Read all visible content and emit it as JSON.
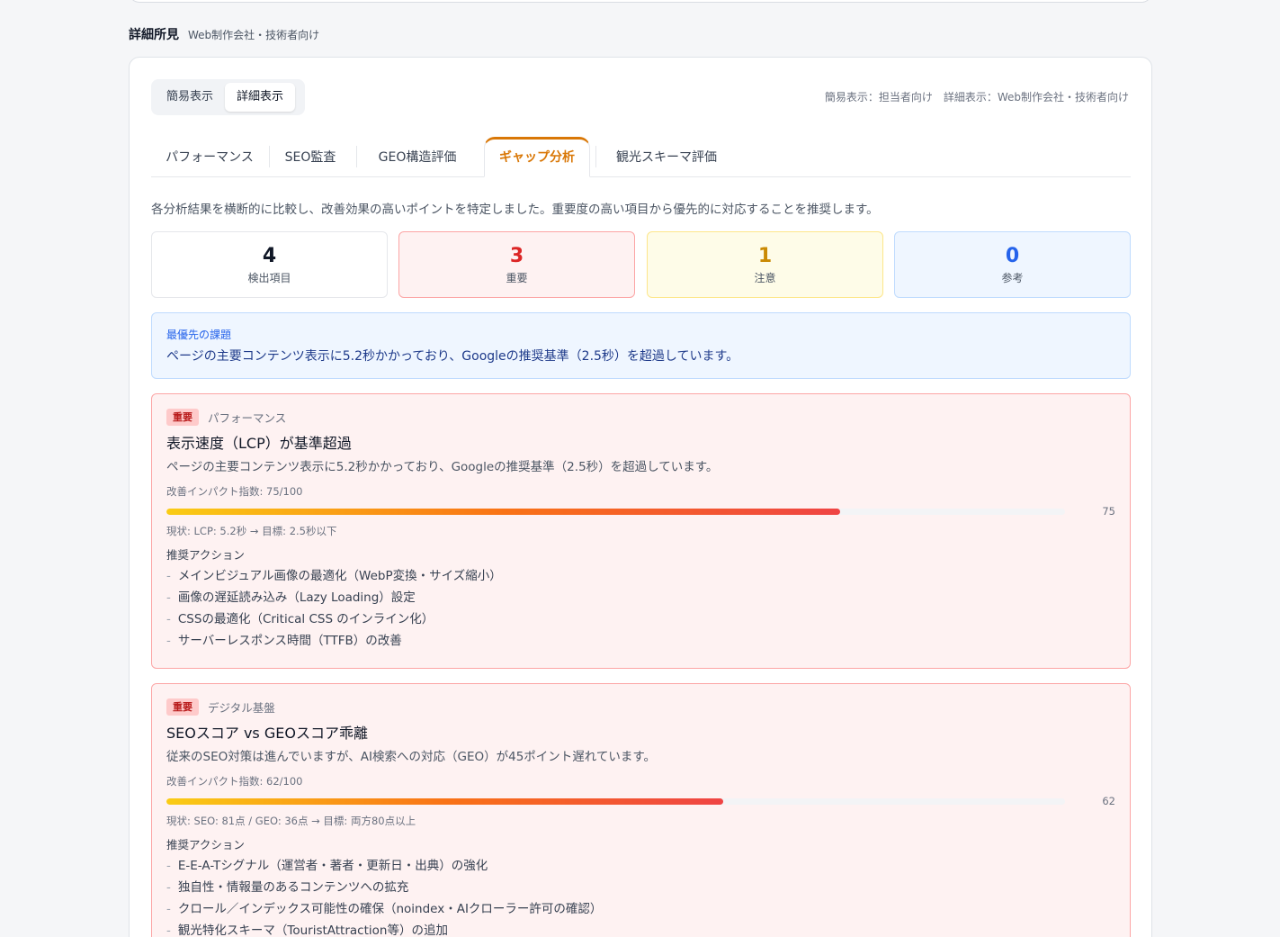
{
  "section": {
    "title": "詳細所見",
    "subtitle": "Web制作会社・技術者向け"
  },
  "toggle": {
    "simple": "簡易表示",
    "detail": "詳細表示",
    "note": "簡易表示：担当者向け　詳細表示：Web制作会社・技術者向け"
  },
  "tabs": [
    "パフォーマンス",
    "SEO監査",
    "GEO構造評価",
    "ギャップ分析",
    "観光スキーマ評価"
  ],
  "active_tab": "ギャップ分析",
  "intro": "各分析結果を横断的に比較し、改善効果の高いポイントを特定しました。重要度の高い項目から優先的に対応することを推奨します。",
  "stats": [
    {
      "value": "4",
      "label": "検出項目"
    },
    {
      "value": "3",
      "label": "重要"
    },
    {
      "value": "1",
      "label": "注意"
    },
    {
      "value": "0",
      "label": "参考"
    }
  ],
  "priority": {
    "label": "最優先の課題",
    "text": "ページの主要コンテンツ表示に5.2秒かかっており、Googleの推奨基準（2.5秒）を超過しています。"
  },
  "colors": {
    "accent": "#d97706",
    "critical": "#dc2626",
    "warning": "#ca8a04",
    "info": "#2563eb"
  },
  "issues": [
    {
      "badge": "重要",
      "category": "パフォーマンス",
      "title": "表示速度（LCP）が基準超過",
      "desc": "ページの主要コンテンツ表示に5.2秒かかっており、Googleの推奨基準（2.5秒）を超過しています。",
      "impact_label": "改善インパクト指数: 75/100",
      "impact": 75,
      "impact_text": "75",
      "current": "現状: LCP: 5.2秒 → 目標: 2.5秒以下",
      "actions_label": "推奨アクション",
      "actions": [
        "メインビジュアル画像の最適化（WebP変換・サイズ縮小）",
        "画像の遅延読み込み（Lazy Loading）設定",
        "CSSの最適化（Critical CSS のインライン化）",
        "サーバーレスポンス時間（TTFB）の改善"
      ]
    },
    {
      "badge": "重要",
      "category": "デジタル基盤",
      "title": "SEOスコア vs GEOスコア乖離",
      "desc": "従来のSEO対策は進んでいますが、AI検索への対応（GEO）が45ポイント遅れています。",
      "impact_label": "改善インパクト指数: 62/100",
      "impact": 62,
      "impact_text": "62",
      "current": "現状: SEO: 81点 / GEO: 36点 → 目標: 両方80点以上",
      "actions_label": "推奨アクション",
      "actions": [
        "E-E-A-Tシグナル（運営者・著者・更新日・出典）の強化",
        "独自性・情報量のあるコンテンツへの拡充",
        "クロール／インデックス可能性の確保（noindex・AIクローラー許可の確認）",
        "観光特化スキーマ（TouristAttraction等）の追加"
      ]
    }
  ]
}
